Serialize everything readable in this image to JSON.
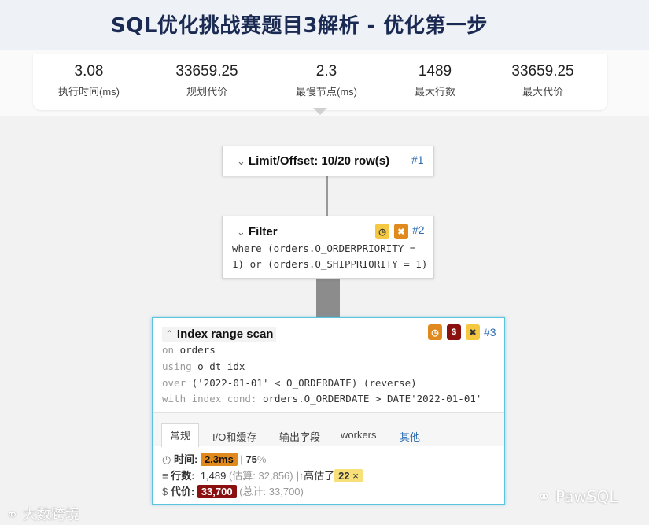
{
  "page": {
    "title": "SQL优化挑战赛题目3解析 - 优化第一步"
  },
  "stats": [
    {
      "value": "3.08",
      "label": "执行时间(ms)"
    },
    {
      "value": "33659.25",
      "label": "规划代价"
    },
    {
      "value": "2.3",
      "label": "最慢节点(ms)"
    },
    {
      "value": "1489",
      "label": "最大行数"
    },
    {
      "value": "33659.25",
      "label": "最大代价"
    }
  ],
  "nodes": {
    "limit": {
      "title": "Limit/Offset: 10/20 row(s)",
      "id": "#1"
    },
    "filter": {
      "title": "Filter",
      "id": "#2",
      "line1": "where (orders.O_ORDERPRIORITY =",
      "line2": "1) or (orders.O_SHIPPRIORITY = 1)"
    },
    "index_scan": {
      "title": "Index range scan",
      "id": "#3",
      "on_kw": "on",
      "on_val": "orders",
      "using_kw": "using",
      "using_val": "o_dt_idx",
      "over_kw": "over",
      "over_val": "('2022-01-01' < O_ORDERDATE) (reverse)",
      "cond_kw": "with index cond:",
      "cond_val": "orders.O_ORDERDATE > DATE'2022-01-01'",
      "tabs": [
        "常规",
        "I/O和缓存",
        "输出字段",
        "workers",
        "其他"
      ],
      "time_label": "时间:",
      "time_value": "2.3ms",
      "time_sep": "|",
      "time_pct": "75",
      "time_pct_sign": "%",
      "rows_label": "行数:",
      "rows_value": "1,489",
      "rows_est": "(估算: 32,856)",
      "rows_sep": "|",
      "rows_over": "高估了",
      "rows_factor": "22",
      "rows_factor_sign": "×",
      "cost_label": "代价:",
      "cost_value": "33,700",
      "cost_total": "(总计: 33,700)"
    }
  },
  "watermarks": {
    "left": "大数跨境",
    "right": "PawSQL"
  },
  "colors": {
    "accent_blue": "#2b6cb0",
    "warn_yellow": "#f5c842",
    "orange": "#e08a1e",
    "dark_red": "#8b1010",
    "selected_border": "#5bc3dd"
  }
}
